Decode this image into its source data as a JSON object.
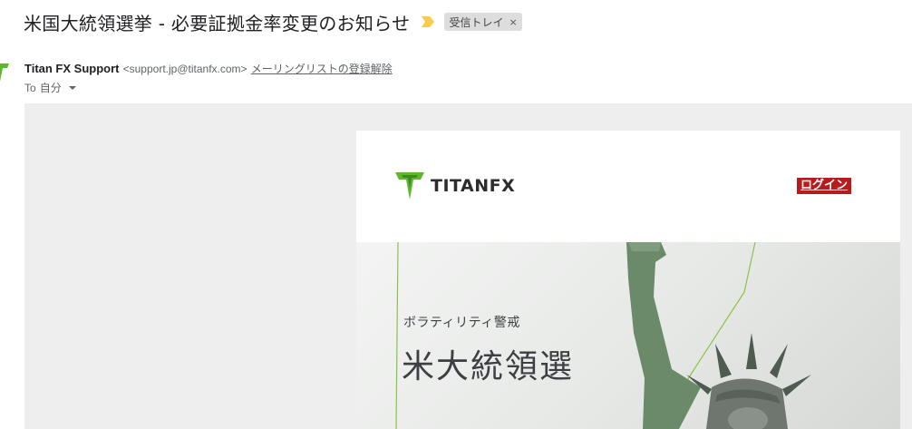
{
  "subject": "米国大統領選挙 - 必要証拠金率変更のお知らせ",
  "label_chip": {
    "text": "受信トレイ",
    "close": "×"
  },
  "sender": {
    "name": "Titan FX Support",
    "email": "<support.jp@titanfx.com>",
    "unsubscribe": "メーリングリストの登録解除",
    "to_prefix": "To",
    "to_value": "自分"
  },
  "newsletter": {
    "logo_text": "TITANFX",
    "login_label": "ログイン",
    "hero_eyebrow": "ボラティリティ警戒",
    "hero_title": "米大統領選"
  },
  "colors": {
    "importance_marker": "#f7cb4d",
    "brand_green": "#5cb82e",
    "login_bg": "#b71c1c",
    "body_bg": "#eeeeee"
  },
  "icons": {
    "importance": "importance-marker-icon",
    "avatar": "titan-avatar-icon",
    "caret": "chevron-down-icon",
    "logo": "titan-logo-icon"
  }
}
